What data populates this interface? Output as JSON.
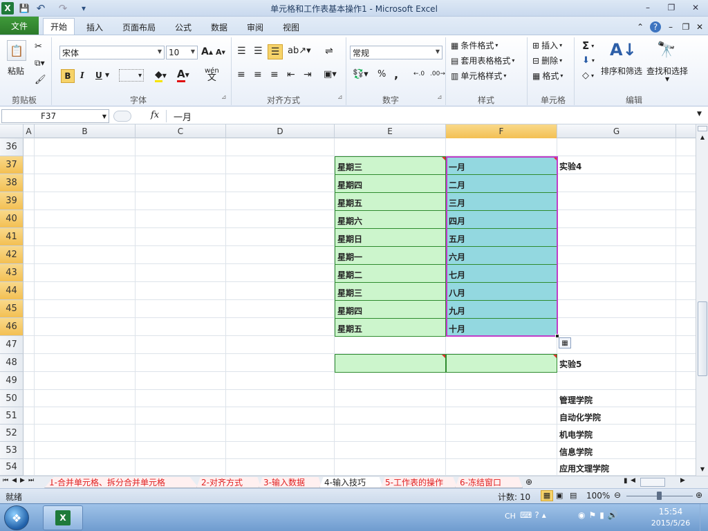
{
  "window": {
    "title": "单元格和工作表基本操作1 - Microsoft Excel",
    "min_glyph": "–",
    "max_glyph": "❐",
    "close_glyph": "✕"
  },
  "quick_access": {
    "excel_glyph": "X",
    "save_glyph": "💾",
    "undo_glyph": "↶",
    "redo_glyph": "↷",
    "customize_glyph": "▾"
  },
  "ribbon": {
    "file_tab": "文件",
    "tabs": [
      "开始",
      "插入",
      "页面布局",
      "公式",
      "数据",
      "审阅",
      "视图"
    ],
    "right_glyphs": [
      "⌃",
      "?",
      "–",
      "❐",
      "✕"
    ],
    "clipboard": {
      "paste": "粘贴",
      "label": "剪贴板"
    },
    "font": {
      "name": "宋体",
      "size": "10",
      "grow": "A",
      "shrink": "A",
      "bold": "B",
      "italic": "I",
      "underline": "U",
      "wen": "wén",
      "label": "字体"
    },
    "alignment": {
      "label": "对齐方式"
    },
    "number": {
      "format": "常规",
      "percent": "%",
      "comma": ",",
      "label": "数字"
    },
    "styles": {
      "conditional": "条件格式",
      "table": "套用表格格式",
      "cell": "单元格样式",
      "label": "样式"
    },
    "cells": {
      "insert": "插入",
      "delete": "删除",
      "format": "格式",
      "label": "单元格"
    },
    "editing": {
      "sigma": "Σ",
      "sort": "排序和筛选",
      "find": "查找和选择",
      "label": "编辑"
    }
  },
  "formula_bar": {
    "name_box": "F37",
    "fx": "fx",
    "content": "一月"
  },
  "columns": [
    "A",
    "B",
    "C",
    "D",
    "E",
    "F",
    "G"
  ],
  "rows": [
    "36",
    "37",
    "38",
    "39",
    "40",
    "41",
    "42",
    "43",
    "44",
    "45",
    "46",
    "47",
    "48",
    "49",
    "50",
    "51",
    "52",
    "53",
    "54"
  ],
  "cells": {
    "weekdays": [
      "星期三",
      "星期四",
      "星期五",
      "星期六",
      "星期日",
      "星期一",
      "星期二",
      "星期三",
      "星期四",
      "星期五"
    ],
    "months": [
      "一月",
      "二月",
      "三月",
      "四月",
      "五月",
      "六月",
      "七月",
      "八月",
      "九月",
      "十月"
    ],
    "g37": "实验4",
    "g48": "实验5",
    "colleges": [
      "管理学院",
      "自动化学院",
      "机电学院",
      "信息学院",
      "应用文理学院"
    ]
  },
  "sheets": [
    {
      "label": "1-合并单元格、拆分合并单元格",
      "active": false
    },
    {
      "label": "2-对齐方式",
      "active": false
    },
    {
      "label": "3-输入数据",
      "active": false
    },
    {
      "label": "4-输入技巧",
      "active": true
    },
    {
      "label": "5-工作表的操作",
      "active": false
    },
    {
      "label": "6-冻结窗口",
      "active": false
    }
  ],
  "status": {
    "ready": "就绪",
    "count": "计数: 10",
    "zoom": "100%"
  },
  "taskbar": {
    "ime": "CH",
    "time": "15:54",
    "date": "2015/5/26"
  },
  "colors": {
    "accent_green": "#2c7a2a",
    "weekday_fill": "#ccf5cc",
    "month_fill": "#93d8e0",
    "selected_header": "#f3c053"
  }
}
